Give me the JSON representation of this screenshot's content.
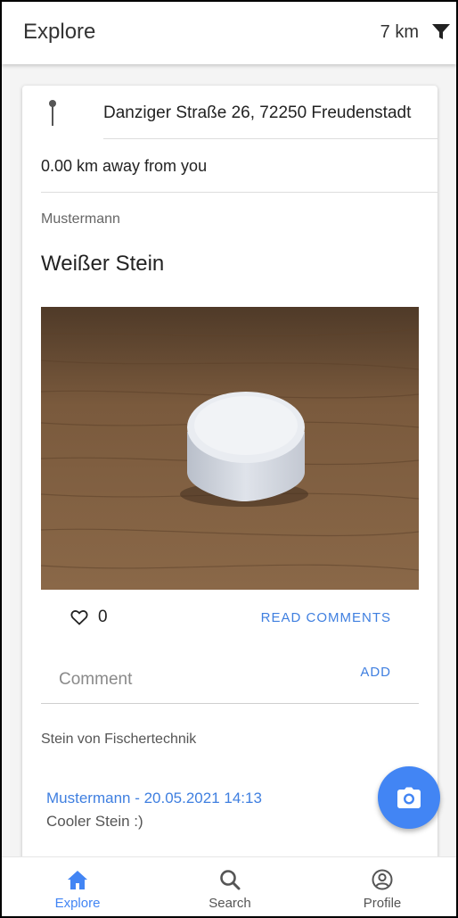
{
  "header": {
    "title": "Explore",
    "distance": "7 km",
    "filter_icon": "filter-icon"
  },
  "post": {
    "address": "Danziger Straße 26, 72250 Freudenstadt",
    "distance_away": "0.00 km away from you",
    "author": "Mustermann",
    "title": "Weißer Stein",
    "photo_subject": "white round stone on wooden table",
    "likes": "0",
    "read_comments_label": "READ COMMENTS",
    "comment_placeholder": "Comment",
    "add_label": "ADD",
    "description": "Stein von Fischertechnik",
    "comments": [
      {
        "meta": "Mustermann - 20.05.2021 14:13",
        "text": "Cooler Stein :)"
      }
    ]
  },
  "fab": {
    "icon": "camera-icon"
  },
  "bottom_nav": {
    "active": "explore",
    "items": [
      {
        "label": "Explore",
        "icon": "home-icon"
      },
      {
        "label": "Search",
        "icon": "search-icon"
      },
      {
        "label": "Profile",
        "icon": "account-circle-icon"
      }
    ]
  },
  "colors": {
    "accent": "#4285f4",
    "link": "#3f7fe0",
    "inactive": "#555555"
  }
}
